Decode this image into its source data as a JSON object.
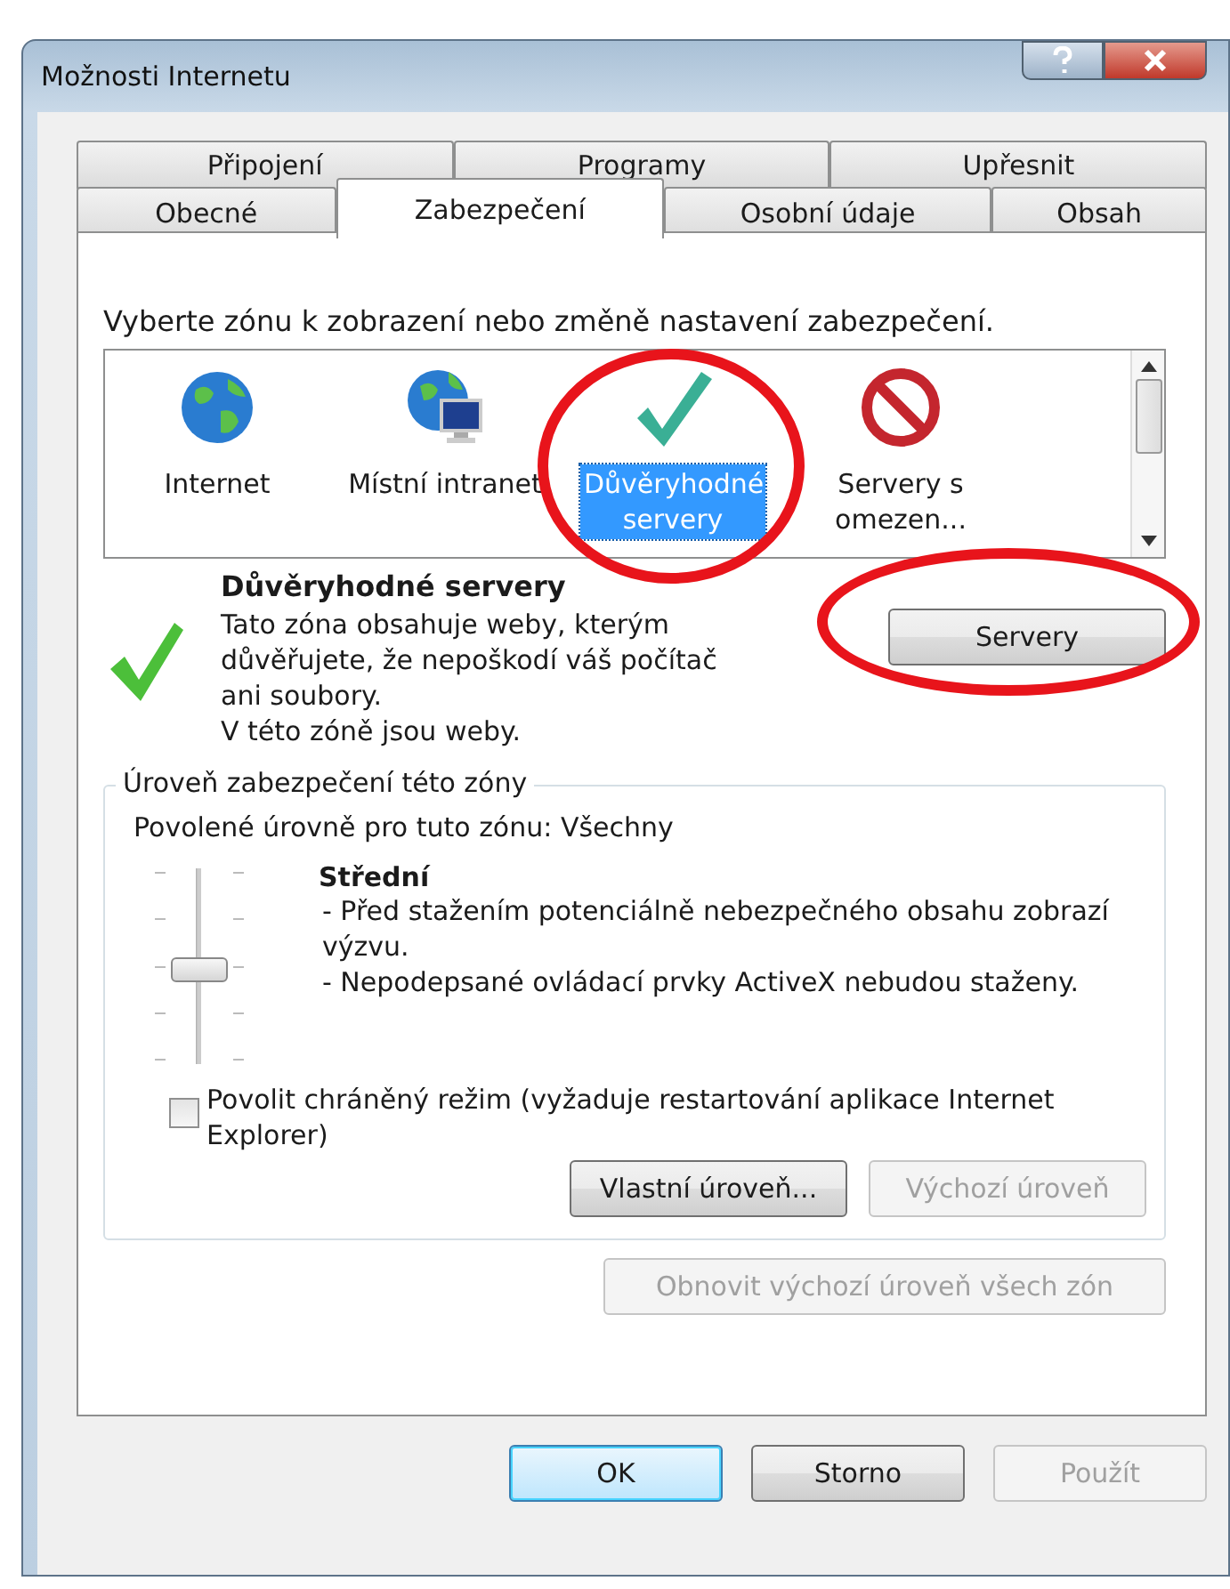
{
  "window": {
    "title": "Možnosti Internetu"
  },
  "tabs_back": [
    {
      "label": "Připojení",
      "selected": false
    },
    {
      "label": "Programy",
      "selected": false
    },
    {
      "label": "Upřesnit",
      "selected": false
    }
  ],
  "tabs_front": [
    {
      "label": "Obecné",
      "selected": false
    },
    {
      "label": "Zabezpečení",
      "selected": true
    },
    {
      "label": "Osobní údaje",
      "selected": false
    },
    {
      "label": "Obsah",
      "selected": false
    }
  ],
  "zone_prompt": "Vyberte zónu k zobrazení nebo změně nastavení zabezpečení.",
  "zones": [
    {
      "kind": "globe",
      "label": "Internet",
      "selected": false
    },
    {
      "kind": "intranet",
      "label": "Místní intranet",
      "selected": false
    },
    {
      "kind": "check",
      "label": "Důvěryhodné servery",
      "selected": true
    },
    {
      "kind": "blocked",
      "label": "Servery s omezen...",
      "selected": false
    }
  ],
  "zone_info": {
    "title": "Důvěryhodné servery",
    "lines": [
      "Tato zóna obsahuje weby, kterým důvěřujete, že nepoškodí váš počítač ani soubory.",
      "V této zóně jsou weby."
    ],
    "button": "Servery"
  },
  "level_group": {
    "legend": "Úroveň zabezpečení této zóny",
    "allowed": "Povolené úrovně pro tuto zónu: Všechny",
    "slider": {
      "level": 0.5
    },
    "level_name": "Střední",
    "points": [
      "- Před stažením potenciálně nebezpečného obsahu zobrazí výzvu.",
      "- Nepodepsané ovládací prvky ActiveX nebudou staženy."
    ],
    "protected_mode": {
      "label": "Povolit chráněný režim (vyžaduje restartování aplikace Internet Explorer)",
      "checked": false
    },
    "buttons": [
      {
        "label": "Vlastní úroveň...",
        "disabled": false
      },
      {
        "label": "Výchozí úroveň",
        "disabled": true
      }
    ]
  },
  "reset_button": {
    "label": "Obnovit výchozí úroveň všech zón",
    "disabled": true
  },
  "dialog_buttons": [
    {
      "label": "OK",
      "disabled": false,
      "default": true
    },
    {
      "label": "Storno",
      "disabled": false,
      "default": false
    },
    {
      "label": "Použít",
      "disabled": true,
      "default": false
    }
  ]
}
